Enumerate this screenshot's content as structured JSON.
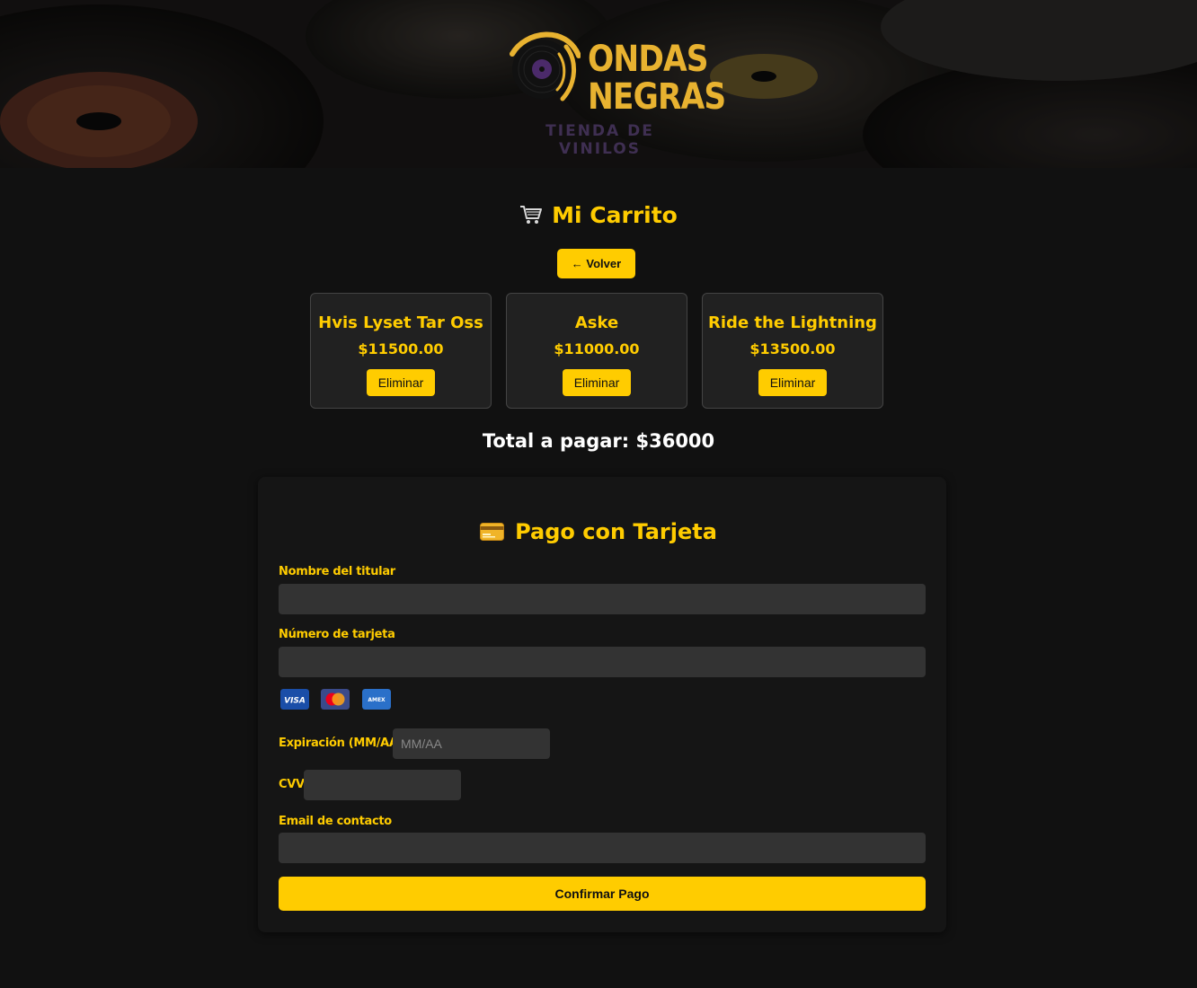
{
  "brand": {
    "name_line1": "ONDAS",
    "name_line2": "NEGRAS",
    "tagline": "TIENDA DE VINILOS"
  },
  "cart": {
    "title": "Mi Carrito",
    "title_icon": "shopping-cart-icon",
    "back_label": "← Volver",
    "items": [
      {
        "name": "Hvis Lyset Tar Oss",
        "price": "$11500.00",
        "remove_label": "Eliminar"
      },
      {
        "name": "Aske",
        "price": "$11000.00",
        "remove_label": "Eliminar"
      },
      {
        "name": "Ride the Lightning",
        "price": "$13500.00",
        "remove_label": "Eliminar"
      }
    ],
    "total_text": "Total a pagar: $36000"
  },
  "payment": {
    "title": "Pago con Tarjeta",
    "title_icon": "credit-card-icon",
    "holder_label": "Nombre del titular",
    "holder_value": "",
    "number_label": "Número de tarjeta",
    "number_value": "",
    "card_brands": [
      "visa-logo",
      "mastercard-logo",
      "amex-logo"
    ],
    "expiry_label": "Expiración (MM/AA)",
    "expiry_placeholder": "MM/AA",
    "cvv_label": "CVV",
    "cvv_value": "",
    "email_label": "Email de contacto",
    "email_value": "",
    "confirm_label": "Confirmar Pago"
  },
  "colors": {
    "accent": "#ffcc00",
    "background": "#111111",
    "card": "#212121",
    "input": "#333333"
  }
}
